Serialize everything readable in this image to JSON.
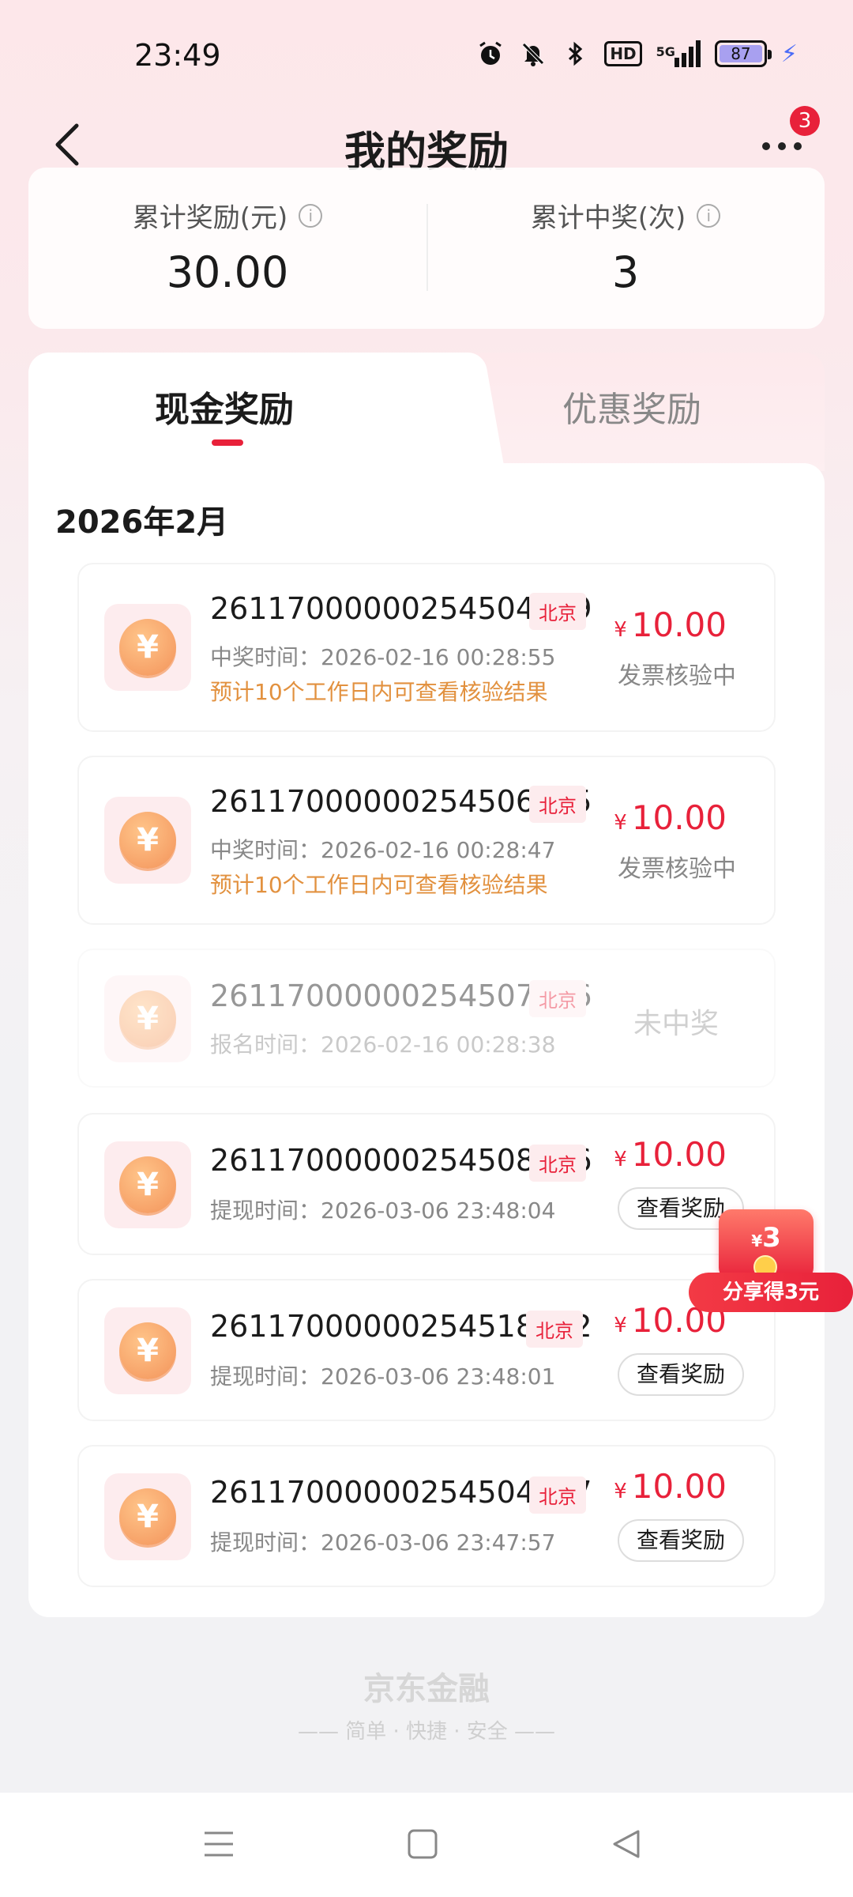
{
  "status_bar": {
    "time": "23:49",
    "signal_label": "5G",
    "hd_label": "HD",
    "battery": "87"
  },
  "header": {
    "title": "我的奖励",
    "notification_count": "3"
  },
  "summary": {
    "total_reward_label": "累计奖励(元)",
    "total_reward_value": "30.00",
    "total_wins_label": "累计中奖(次)",
    "total_wins_value": "3"
  },
  "tabs": {
    "cash": "现金奖励",
    "coupon": "优惠奖励"
  },
  "month": "2026年2月",
  "rewards": [
    {
      "order_no": "26117000000254504999",
      "city": "北京",
      "time_label": "中奖时间：",
      "time": "2026-02-16 00:28:55",
      "note": "预计10个工作日内可查看核验结果",
      "yen": "¥",
      "amount": "10.00",
      "status": "发票核验中"
    },
    {
      "order_no": "26117000000254506505",
      "city": "北京",
      "time_label": "中奖时间：",
      "time": "2026-02-16 00:28:47",
      "note": "预计10个工作日内可查看核验结果",
      "yen": "¥",
      "amount": "10.00",
      "status": "发票核验中"
    },
    {
      "order_no": "26117000000254507366",
      "city": "北京",
      "time_label": "报名时间：",
      "time": "2026-02-16 00:28:38",
      "status": "未中奖"
    },
    {
      "order_no": "26117000000254508326",
      "city": "北京",
      "time_label": "提现时间：",
      "time": "2026-03-06 23:48:04",
      "yen": "¥",
      "amount": "10.00",
      "action": "查看奖励"
    },
    {
      "order_no": "26117000000254518682",
      "city": "北京",
      "time_label": "提现时间：",
      "time": "2026-03-06 23:48:01",
      "yen": "¥",
      "amount": "10.00",
      "action": "查看奖励"
    },
    {
      "order_no": "26117000000254504807",
      "city": "北京",
      "time_label": "提现时间：",
      "time": "2026-03-06 23:47:57",
      "yen": "¥",
      "amount": "10.00",
      "action": "查看奖励"
    }
  ],
  "share": {
    "yen": "¥",
    "amount": "3",
    "label": "分享得3元"
  },
  "footer": {
    "brand": "京东金融",
    "slogan": "简单 · 快捷 · 安全"
  },
  "colors": {
    "accent": "#e8213a",
    "note": "#e2913f",
    "coin": "#f3935a"
  }
}
